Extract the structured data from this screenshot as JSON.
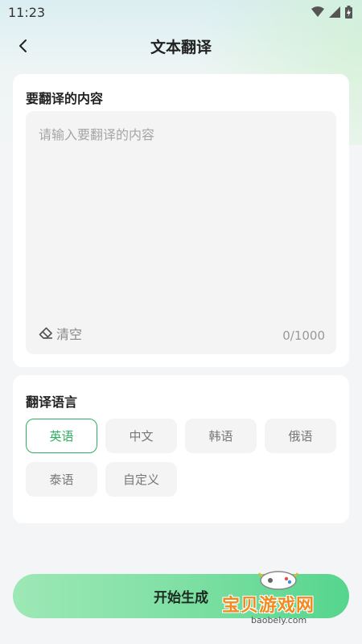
{
  "status": {
    "time": "11:23"
  },
  "header": {
    "title": "文本翻译"
  },
  "input_card": {
    "title": "要翻译的内容",
    "placeholder": "请输入要翻译的内容",
    "clear_label": "清空",
    "counter": "0/1000"
  },
  "lang_card": {
    "title": "翻译语言",
    "options": [
      "英语",
      "中文",
      "韩语",
      "俄语",
      "泰语",
      "自定义"
    ],
    "selected": "英语"
  },
  "start_button": {
    "label": "开始生成"
  },
  "watermark": {
    "text": "宝贝游戏网",
    "url": "baobely.com"
  },
  "colors": {
    "accent": "#2fae5f",
    "button_gradient_start": "#9de8b6",
    "button_gradient_end": "#55d58e"
  }
}
